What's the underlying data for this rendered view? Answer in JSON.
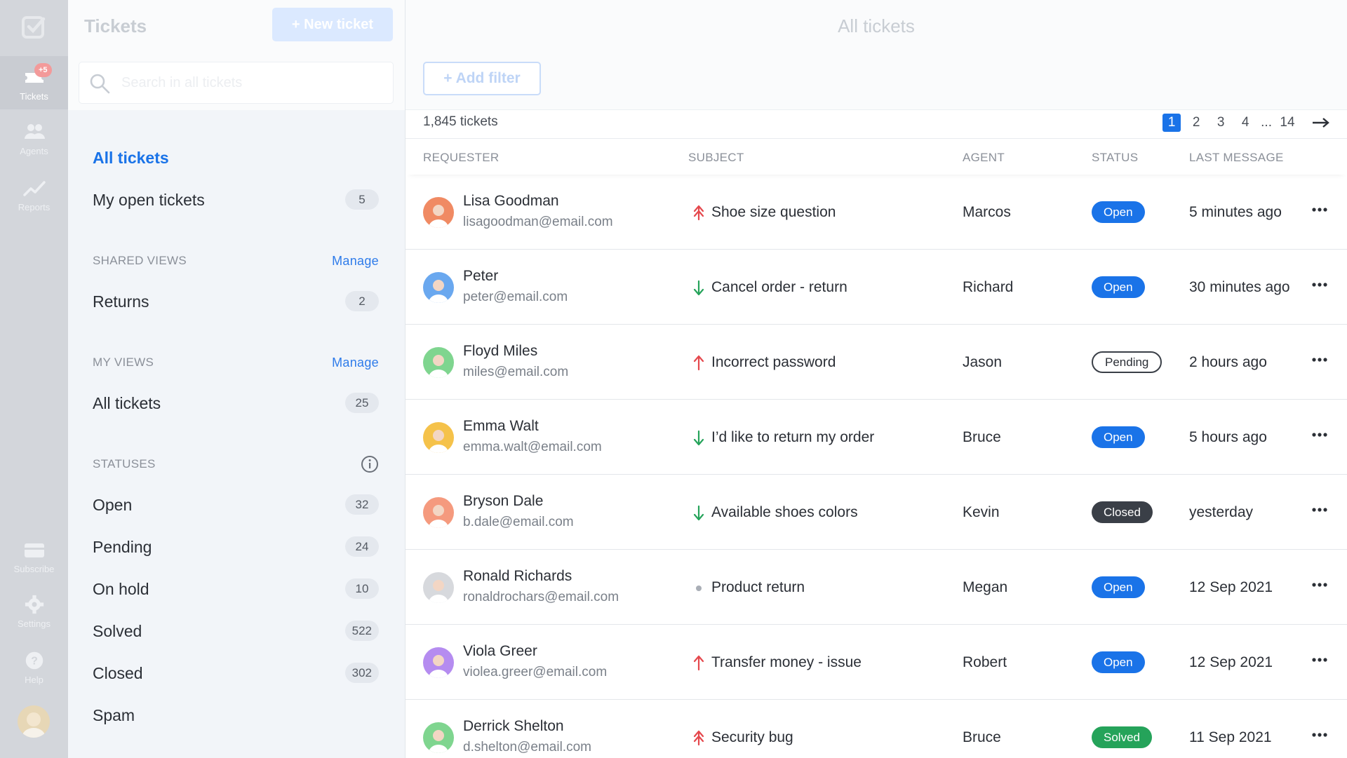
{
  "rail": {
    "tickets_label": "Tickets",
    "tickets_badge": "+5",
    "agents_label": "Agents",
    "reports_label": "Reports",
    "subscribe_label": "Subscribe",
    "settings_label": "Settings",
    "help_label": "Help"
  },
  "nav": {
    "title": "Tickets",
    "new_ticket_label": "+ New ticket",
    "search_placeholder": "Search in all tickets",
    "all_tickets": "All tickets",
    "my_open": {
      "label": "My open tickets",
      "count": "5"
    },
    "shared_views": {
      "title": "SHARED VIEWS",
      "manage": "Manage",
      "items": [
        {
          "label": "Returns",
          "count": "2"
        }
      ]
    },
    "my_views": {
      "title": "MY VIEWS",
      "manage": "Manage",
      "items": [
        {
          "label": "All tickets",
          "count": "25"
        }
      ]
    },
    "statuses": {
      "title": "STATUSES",
      "items": [
        {
          "label": "Open",
          "count": "32"
        },
        {
          "label": "Pending",
          "count": "24"
        },
        {
          "label": "On hold",
          "count": "10"
        },
        {
          "label": "Solved",
          "count": "522"
        },
        {
          "label": "Closed",
          "count": "302"
        },
        {
          "label": "Spam",
          "count": ""
        }
      ]
    }
  },
  "main": {
    "title": "All tickets",
    "add_filter_label": "+ Add filter",
    "total": "1,845 tickets",
    "pages": [
      "1",
      "2",
      "3",
      "4"
    ],
    "pages_dots": "...",
    "last_page": "14",
    "columns": {
      "requester": "REQUESTER",
      "subject": "SUBJECT",
      "agent": "AGENT",
      "status": "STATUS",
      "last_message": "LAST MESSAGE"
    },
    "rows": [
      {
        "name": "Lisa Goodman",
        "email": "lisagoodman@email.com",
        "priority": "urgent",
        "subject": "Shoe size question",
        "agent": "Marcos",
        "status": "Open",
        "last": "5 minutes ago"
      },
      {
        "name": "Peter",
        "email": "peter@email.com",
        "priority": "low",
        "subject": "Cancel order - return",
        "agent": "Richard",
        "status": "Open",
        "last": "30 minutes ago"
      },
      {
        "name": "Floyd Miles",
        "email": "miles@email.com",
        "priority": "high",
        "subject": "Incorrect password",
        "agent": "Jason",
        "status": "Pending",
        "last": "2 hours ago"
      },
      {
        "name": "Emma Walt",
        "email": "emma.walt@email.com",
        "priority": "low",
        "subject": "I’d like to return my order",
        "agent": "Bruce",
        "status": "Open",
        "last": "5 hours ago"
      },
      {
        "name": "Bryson Dale",
        "email": "b.dale@email.com",
        "priority": "low",
        "subject": "Available shoes colors",
        "agent": "Kevin",
        "status": "Closed",
        "last": "yesterday"
      },
      {
        "name": "Ronald Richards",
        "email": "ronaldrochars@email.com",
        "priority": "normal",
        "subject": "Product return",
        "agent": "Megan",
        "status": "Open",
        "last": "12 Sep 2021"
      },
      {
        "name": "Viola Greer",
        "email": "violea.greer@email.com",
        "priority": "high",
        "subject": "Transfer money - issue",
        "agent": "Robert",
        "status": "Open",
        "last": "12 Sep 2021"
      },
      {
        "name": "Derrick Shelton",
        "email": "d.shelton@email.com",
        "priority": "urgent",
        "subject": "Security bug",
        "agent": "Bruce",
        "status": "Solved",
        "last": "11 Sep 2021"
      }
    ]
  },
  "colors": {
    "accent": "#1a73e8",
    "priority_up": "#e5484d",
    "priority_down": "#25a35a",
    "solved": "#25a35a",
    "closed": "#3a3f47"
  },
  "avatar_colors": [
    "#f08a63",
    "#6aa8ef",
    "#7fd58f",
    "#f5c24a",
    "#f59a7e",
    "#d7d9dd",
    "#b58cf0",
    "#7fd58f"
  ]
}
